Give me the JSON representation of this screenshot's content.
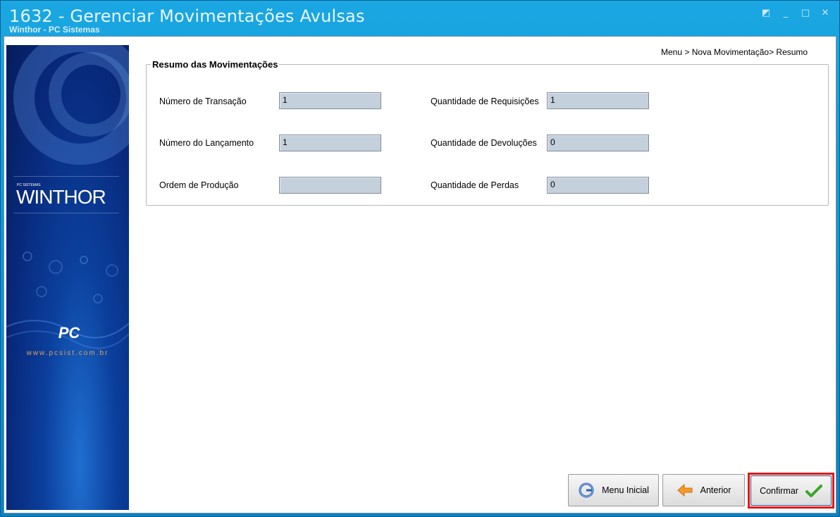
{
  "window": {
    "title": "1632 - Gerenciar Movimentações Avulsas",
    "subtitle": "Winthor - PC Sistemas",
    "controls": [
      "restore-icon",
      "minimize-icon",
      "maximize-icon",
      "close-icon"
    ]
  },
  "banner": {
    "brand_small": "PC SISTEMAS",
    "brand": "WINTHOR",
    "pc_logo": "PC",
    "site": "www.pcsist.com.br"
  },
  "breadcrumb": "Menu > Nova Movimentação> Resumo",
  "summary": {
    "title": "Resumo das Movimentações",
    "numero_transacao": {
      "label": "Número de Transação",
      "value": "1"
    },
    "numero_lancamento": {
      "label": "Número do Lançamento",
      "value": "1"
    },
    "ordem_producao": {
      "label": "Ordem de Produção",
      "value": ""
    },
    "qtd_requisicoes": {
      "label": "Quantidade de Requisições",
      "value": "1"
    },
    "qtd_devolucoes": {
      "label": "Quantidade de Devoluções",
      "value": "0"
    },
    "qtd_perdas": {
      "label": "Quantidade de Perdas",
      "value": "0"
    }
  },
  "buttons": {
    "menu_inicial": {
      "label": "Menu Inicial",
      "icon": "home-refresh-icon"
    },
    "anterior": {
      "label": "Anterior",
      "icon": "arrow-left-icon"
    },
    "confirmar": {
      "label": "Confirmar",
      "icon": "checkmark-icon"
    }
  },
  "colors": {
    "titlebar": "#1aa7e2",
    "field_bg": "#c4d0dc",
    "highlight": "#e01818"
  }
}
